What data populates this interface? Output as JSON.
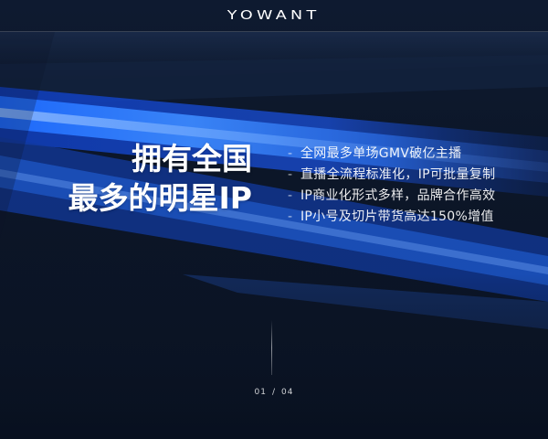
{
  "brand": {
    "logo_text": "YOWANT"
  },
  "headline": {
    "line1": "拥有全国",
    "line2": "最多的明星IP"
  },
  "bullets": [
    "全网最多单场GMV破亿主播",
    "直播全流程标准化，IP可批量复制",
    "IP商业化形式多样，品牌合作高效",
    "IP小号及切片带货高达150%增值"
  ],
  "bullet_marker": "-",
  "pagination": {
    "current": "01",
    "separator": "/",
    "total": "04"
  },
  "colors": {
    "background": "#0b1426",
    "streak_bright": "#3d8bff",
    "streak_deep": "#1a4fd6",
    "text": "#ffffff"
  }
}
